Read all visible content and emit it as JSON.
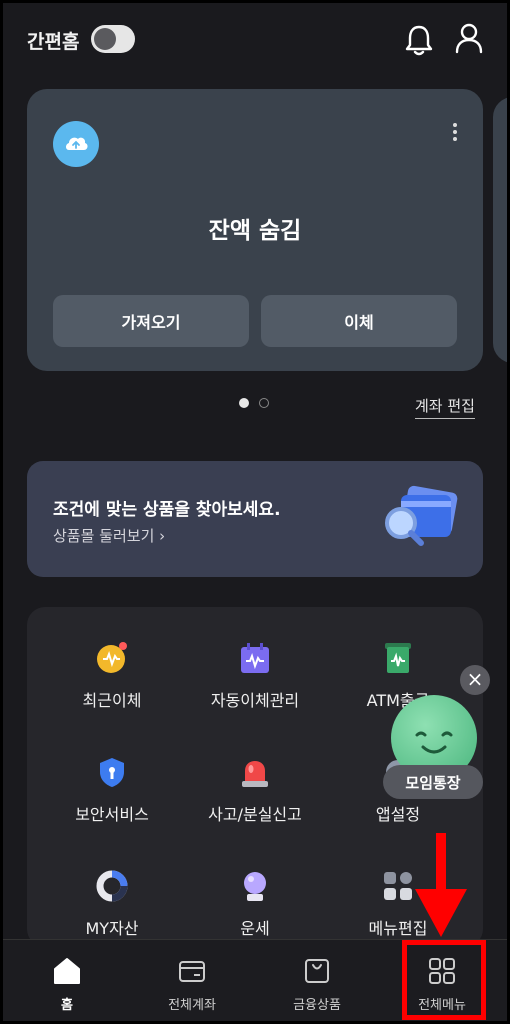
{
  "topbar": {
    "simple_home_label": "간편홈",
    "simple_home_toggle": "off",
    "bell_icon": "bell-icon",
    "profile_icon": "person-icon"
  },
  "account_card": {
    "logo_icon": "recycle-cloud-icon",
    "title": "잔액 숨김",
    "more_icon": "kebab-icon",
    "buttons": {
      "bring": "가져오기",
      "transfer": "이체"
    }
  },
  "pager": {
    "count": 2,
    "active": 1
  },
  "edit_accounts": "계좌 편집",
  "promo": {
    "title": "조건에 맞는 상품을 찾아보세요.",
    "subtitle": "상품몰 둘러보기 ›",
    "illustration": "magnifier-card-icon"
  },
  "menu": {
    "items": [
      {
        "label": "최근이체",
        "icon": "recent-transfer-icon"
      },
      {
        "label": "자동이체관리",
        "icon": "calendar-transfer-icon"
      },
      {
        "label": "ATM출금",
        "icon": "atm-icon"
      },
      {
        "label": "보안서비스",
        "icon": "shield-icon"
      },
      {
        "label": "사고/분실신고",
        "icon": "siren-icon"
      },
      {
        "label": "앱설정",
        "icon": "settings-icon"
      },
      {
        "label": "MY자산",
        "icon": "donut-chart-icon"
      },
      {
        "label": "운세",
        "icon": "crystal-ball-icon"
      },
      {
        "label": "메뉴편집",
        "icon": "grid-edit-icon"
      }
    ]
  },
  "floating": {
    "close_icon": "close-icon",
    "close_glyph": "×",
    "label": "모임통장"
  },
  "bottom_nav": {
    "items": [
      {
        "label": "홈",
        "icon": "home-icon"
      },
      {
        "label": "전체계좌",
        "icon": "wallet-icon"
      },
      {
        "label": "금융상품",
        "icon": "bag-icon"
      },
      {
        "label": "전체메뉴",
        "icon": "grid-icon"
      }
    ]
  },
  "colors": {
    "background": "#1a1a1e",
    "card": "#3a424c",
    "annotation": "#ff0000"
  }
}
